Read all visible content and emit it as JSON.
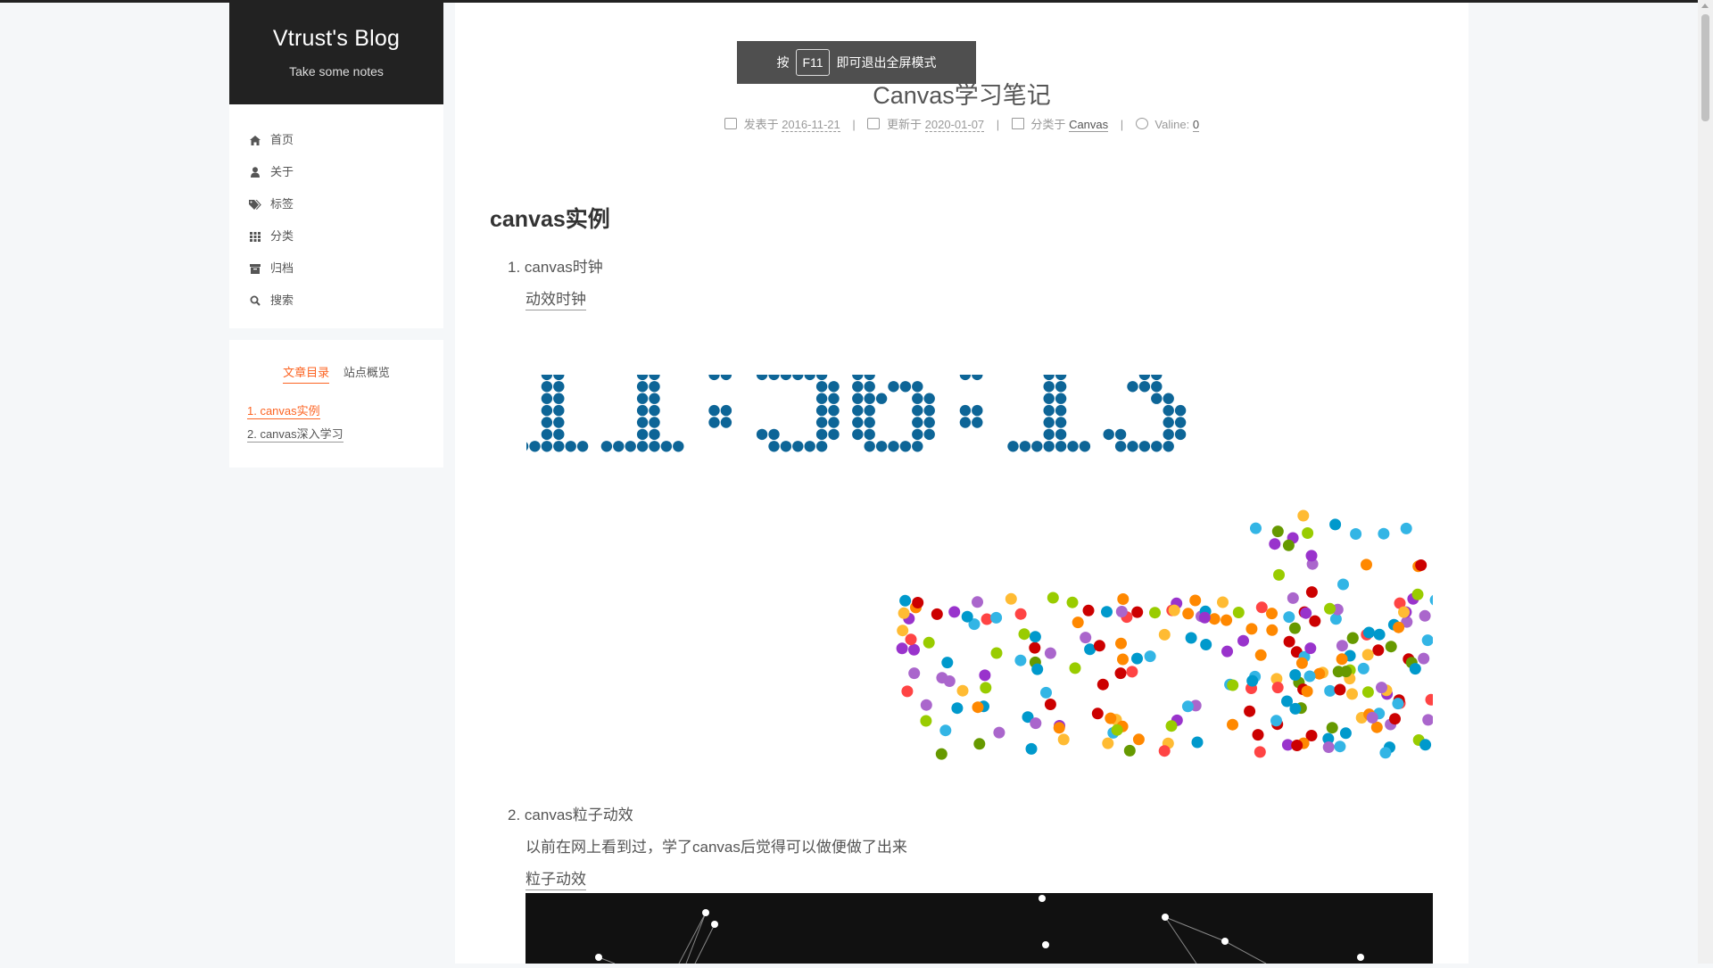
{
  "brand": {
    "title": "Vtrust's Blog",
    "subtitle": "Take some notes"
  },
  "menu": {
    "items": [
      {
        "icon": "home-icon",
        "label": "首页"
      },
      {
        "icon": "user-icon",
        "label": "关于"
      },
      {
        "icon": "tags-icon",
        "label": "标签"
      },
      {
        "icon": "grid-icon",
        "label": "分类"
      },
      {
        "icon": "archive-icon",
        "label": "归档"
      },
      {
        "icon": "search-icon",
        "label": "搜索"
      }
    ]
  },
  "toc": {
    "tabs": [
      "文章目录",
      "站点概览"
    ],
    "items": [
      "1. canvas实例",
      "2. canvas深入学习"
    ]
  },
  "fullscreen_toast": {
    "pre": "按",
    "key": "F11",
    "post": "即可退出全屏模式"
  },
  "post": {
    "title": "Canvas学习笔记",
    "meta": {
      "posted_label": "发表于",
      "posted": "2016-11-21",
      "updated_label": "更新于",
      "updated": "2020-01-07",
      "category_label": "分类于",
      "category": "Canvas",
      "comments_label": "Valine:",
      "comments": "0"
    },
    "heading": "canvas实例",
    "item1": {
      "num": "1.",
      "title": "canvas时钟",
      "link": "动效时钟"
    },
    "clock_time": "11:56:13",
    "item2": {
      "num": "2.",
      "title": "canvas粒子动效",
      "desc": "以前在网上看到过，学了canvas后觉得可以做便做了出来",
      "link": "粒子动效"
    }
  },
  "colors": {
    "accent": "#fc6423",
    "clock_dot": "#0d6597",
    "particles": [
      "#33b5e5",
      "#0099cc",
      "#aa66cc",
      "#9933cc",
      "#99cc00",
      "#669900",
      "#ffbb33",
      "#ff8800",
      "#ff4444",
      "#cc0000"
    ]
  }
}
